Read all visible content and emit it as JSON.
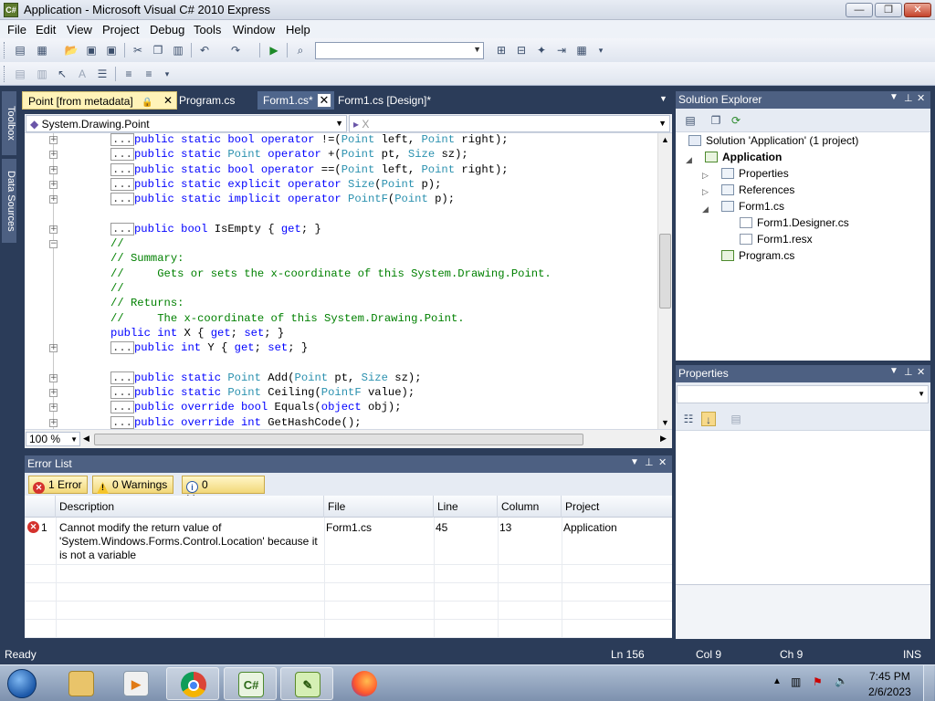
{
  "window": {
    "title": "Application - Microsoft Visual C# 2010 Express",
    "icon_label": "C#",
    "min": "—",
    "max": "❐",
    "close": "✕"
  },
  "menu": [
    "File",
    "Edit",
    "View",
    "Project",
    "Debug",
    "Tools",
    "Window",
    "Help"
  ],
  "toolbar": {
    "config_combo": ""
  },
  "side_tabs": {
    "toolbox": "Toolbox",
    "data_sources": "Data Sources"
  },
  "doc_tabs": {
    "tab1": "Point [from metadata]",
    "tab2": "Program.cs",
    "tab3": "Form1.cs*",
    "tab4": "Form1.cs [Design]*",
    "close_glyph": "✕"
  },
  "editor": {
    "type_combo": "System.Drawing.Point",
    "member_combo": "X",
    "zoom": "100 %",
    "lines": [
      {
        "fold": "+",
        "box": "...",
        "code": [
          [
            "kw",
            "public static bool operator "
          ],
          [
            "",
            "!=("
          ],
          [
            "ty",
            "Point"
          ],
          [
            "",
            " left, "
          ],
          [
            "ty",
            "Point"
          ],
          [
            "",
            " right);"
          ]
        ]
      },
      {
        "fold": "+",
        "box": "...",
        "code": [
          [
            "kw",
            "public static "
          ],
          [
            "ty",
            "Point"
          ],
          [
            "",
            " "
          ],
          [
            "kw",
            "operator "
          ],
          [
            "",
            "+("
          ],
          [
            "ty",
            "Point"
          ],
          [
            "",
            " pt, "
          ],
          [
            "ty",
            "Size"
          ],
          [
            "",
            " sz);"
          ]
        ]
      },
      {
        "fold": "+",
        "box": "...",
        "code": [
          [
            "kw",
            "public static bool operator "
          ],
          [
            "",
            "==("
          ],
          [
            "ty",
            "Point"
          ],
          [
            "",
            " left, "
          ],
          [
            "ty",
            "Point"
          ],
          [
            "",
            " right);"
          ]
        ]
      },
      {
        "fold": "+",
        "box": "...",
        "code": [
          [
            "kw",
            "public static explicit operator "
          ],
          [
            "ty",
            "Size"
          ],
          [
            "",
            "("
          ],
          [
            "ty",
            "Point"
          ],
          [
            "",
            " p);"
          ]
        ]
      },
      {
        "fold": "+",
        "box": "...",
        "code": [
          [
            "kw",
            "public static implicit operator "
          ],
          [
            "ty",
            "PointF"
          ],
          [
            "",
            "("
          ],
          [
            "ty",
            "Point"
          ],
          [
            "",
            " p);"
          ]
        ]
      },
      {
        "fold": "",
        "box": "",
        "code": []
      },
      {
        "fold": "+",
        "box": "...",
        "code": [
          [
            "kw",
            "public bool "
          ],
          [
            "",
            "IsEmpty { "
          ],
          [
            "kw",
            "get"
          ],
          [
            "",
            "; }"
          ]
        ]
      },
      {
        "fold": "−",
        "box": "",
        "code": [
          [
            "cm",
            "//"
          ]
        ]
      },
      {
        "fold": "",
        "box": "",
        "code": [
          [
            "cm",
            "// Summary:"
          ]
        ]
      },
      {
        "fold": "",
        "box": "",
        "code": [
          [
            "cm",
            "//     Gets or sets the x-coordinate of this System.Drawing.Point."
          ]
        ]
      },
      {
        "fold": "",
        "box": "",
        "code": [
          [
            "cm",
            "//"
          ]
        ]
      },
      {
        "fold": "",
        "box": "",
        "code": [
          [
            "cm",
            "// Returns:"
          ]
        ]
      },
      {
        "fold": "",
        "box": "",
        "code": [
          [
            "cm",
            "//     The x-coordinate of this System.Drawing.Point."
          ]
        ]
      },
      {
        "fold": "",
        "box": "",
        "code": [
          [
            "kw",
            "public int "
          ],
          [
            "",
            "X { "
          ],
          [
            "kw",
            "get"
          ],
          [
            "",
            "; "
          ],
          [
            "kw",
            "set"
          ],
          [
            "",
            "; }"
          ]
        ]
      },
      {
        "fold": "+",
        "box": "...",
        "code": [
          [
            "kw",
            "public int "
          ],
          [
            "",
            "Y { "
          ],
          [
            "kw",
            "get"
          ],
          [
            "",
            "; "
          ],
          [
            "kw",
            "set"
          ],
          [
            "",
            "; }"
          ]
        ]
      },
      {
        "fold": "",
        "box": "",
        "code": []
      },
      {
        "fold": "+",
        "box": "...",
        "code": [
          [
            "kw",
            "public static "
          ],
          [
            "ty",
            "Point"
          ],
          [
            "",
            " Add("
          ],
          [
            "ty",
            "Point"
          ],
          [
            "",
            " pt, "
          ],
          [
            "ty",
            "Size"
          ],
          [
            "",
            " sz);"
          ]
        ]
      },
      {
        "fold": "+",
        "box": "...",
        "code": [
          [
            "kw",
            "public static "
          ],
          [
            "ty",
            "Point"
          ],
          [
            "",
            " Ceiling("
          ],
          [
            "ty",
            "PointF"
          ],
          [
            "",
            " value);"
          ]
        ]
      },
      {
        "fold": "+",
        "box": "...",
        "code": [
          [
            "kw",
            "public override bool "
          ],
          [
            "",
            "Equals("
          ],
          [
            "kw",
            "object"
          ],
          [
            "",
            " obj);"
          ]
        ]
      },
      {
        "fold": "+",
        "box": "...",
        "code": [
          [
            "kw",
            "public override int "
          ],
          [
            "",
            "GetHashCode();"
          ]
        ]
      }
    ]
  },
  "error_list": {
    "title": "Error List",
    "errors_btn": "1 Error",
    "warnings_btn": "0 Warnings",
    "messages_btn": "0 Messages",
    "columns": {
      "description": "Description",
      "file": "File",
      "line": "Line",
      "column": "Column",
      "project": "Project"
    },
    "rows": [
      {
        "num": "1",
        "description": "Cannot modify the return value of 'System.Windows.Forms.Control.Location' because it is not a variable",
        "file": "Form1.cs",
        "line": "45",
        "column": "13",
        "project": "Application"
      }
    ]
  },
  "solution_explorer": {
    "title": "Solution Explorer",
    "solution": "Solution 'Application' (1 project)",
    "project": "Application",
    "properties": "Properties",
    "references": "References",
    "form1": "Form1.cs",
    "form1_designer": "Form1.Designer.cs",
    "form1_resx": "Form1.resx",
    "program": "Program.cs"
  },
  "properties_panel": {
    "title": "Properties"
  },
  "status": {
    "ready": "Ready",
    "ln": "Ln 156",
    "col": "Col 9",
    "ch": "Ch 9",
    "ins": "INS"
  },
  "taskbar": {
    "time": "7:45 PM",
    "date": "2/6/2023",
    "vs_label": "C#"
  }
}
